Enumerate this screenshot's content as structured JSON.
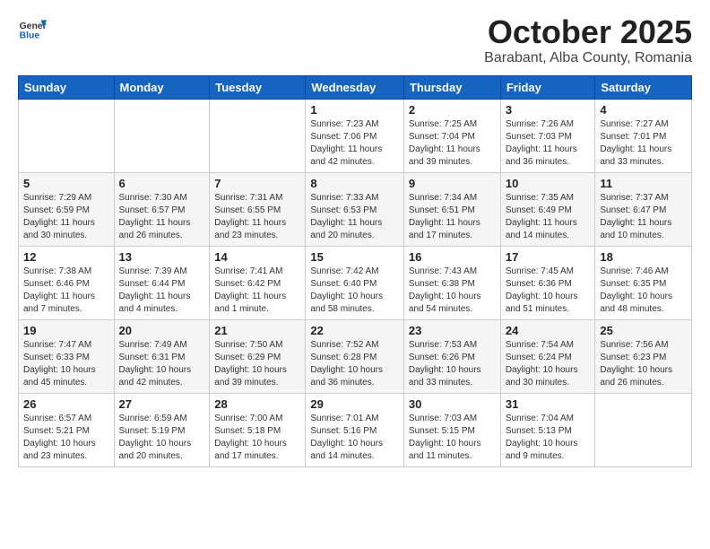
{
  "header": {
    "logo_general": "General",
    "logo_blue": "Blue",
    "month_title": "October 2025",
    "location": "Barabant, Alba County, Romania"
  },
  "weekdays": [
    "Sunday",
    "Monday",
    "Tuesday",
    "Wednesday",
    "Thursday",
    "Friday",
    "Saturday"
  ],
  "weeks": [
    [
      {
        "day": "",
        "info": ""
      },
      {
        "day": "",
        "info": ""
      },
      {
        "day": "",
        "info": ""
      },
      {
        "day": "1",
        "info": "Sunrise: 7:23 AM\nSunset: 7:06 PM\nDaylight: 11 hours and 42 minutes."
      },
      {
        "day": "2",
        "info": "Sunrise: 7:25 AM\nSunset: 7:04 PM\nDaylight: 11 hours and 39 minutes."
      },
      {
        "day": "3",
        "info": "Sunrise: 7:26 AM\nSunset: 7:03 PM\nDaylight: 11 hours and 36 minutes."
      },
      {
        "day": "4",
        "info": "Sunrise: 7:27 AM\nSunset: 7:01 PM\nDaylight: 11 hours and 33 minutes."
      }
    ],
    [
      {
        "day": "5",
        "info": "Sunrise: 7:29 AM\nSunset: 6:59 PM\nDaylight: 11 hours and 30 minutes."
      },
      {
        "day": "6",
        "info": "Sunrise: 7:30 AM\nSunset: 6:57 PM\nDaylight: 11 hours and 26 minutes."
      },
      {
        "day": "7",
        "info": "Sunrise: 7:31 AM\nSunset: 6:55 PM\nDaylight: 11 hours and 23 minutes."
      },
      {
        "day": "8",
        "info": "Sunrise: 7:33 AM\nSunset: 6:53 PM\nDaylight: 11 hours and 20 minutes."
      },
      {
        "day": "9",
        "info": "Sunrise: 7:34 AM\nSunset: 6:51 PM\nDaylight: 11 hours and 17 minutes."
      },
      {
        "day": "10",
        "info": "Sunrise: 7:35 AM\nSunset: 6:49 PM\nDaylight: 11 hours and 14 minutes."
      },
      {
        "day": "11",
        "info": "Sunrise: 7:37 AM\nSunset: 6:47 PM\nDaylight: 11 hours and 10 minutes."
      }
    ],
    [
      {
        "day": "12",
        "info": "Sunrise: 7:38 AM\nSunset: 6:46 PM\nDaylight: 11 hours and 7 minutes."
      },
      {
        "day": "13",
        "info": "Sunrise: 7:39 AM\nSunset: 6:44 PM\nDaylight: 11 hours and 4 minutes."
      },
      {
        "day": "14",
        "info": "Sunrise: 7:41 AM\nSunset: 6:42 PM\nDaylight: 11 hours and 1 minute."
      },
      {
        "day": "15",
        "info": "Sunrise: 7:42 AM\nSunset: 6:40 PM\nDaylight: 10 hours and 58 minutes."
      },
      {
        "day": "16",
        "info": "Sunrise: 7:43 AM\nSunset: 6:38 PM\nDaylight: 10 hours and 54 minutes."
      },
      {
        "day": "17",
        "info": "Sunrise: 7:45 AM\nSunset: 6:36 PM\nDaylight: 10 hours and 51 minutes."
      },
      {
        "day": "18",
        "info": "Sunrise: 7:46 AM\nSunset: 6:35 PM\nDaylight: 10 hours and 48 minutes."
      }
    ],
    [
      {
        "day": "19",
        "info": "Sunrise: 7:47 AM\nSunset: 6:33 PM\nDaylight: 10 hours and 45 minutes."
      },
      {
        "day": "20",
        "info": "Sunrise: 7:49 AM\nSunset: 6:31 PM\nDaylight: 10 hours and 42 minutes."
      },
      {
        "day": "21",
        "info": "Sunrise: 7:50 AM\nSunset: 6:29 PM\nDaylight: 10 hours and 39 minutes."
      },
      {
        "day": "22",
        "info": "Sunrise: 7:52 AM\nSunset: 6:28 PM\nDaylight: 10 hours and 36 minutes."
      },
      {
        "day": "23",
        "info": "Sunrise: 7:53 AM\nSunset: 6:26 PM\nDaylight: 10 hours and 33 minutes."
      },
      {
        "day": "24",
        "info": "Sunrise: 7:54 AM\nSunset: 6:24 PM\nDaylight: 10 hours and 30 minutes."
      },
      {
        "day": "25",
        "info": "Sunrise: 7:56 AM\nSunset: 6:23 PM\nDaylight: 10 hours and 26 minutes."
      }
    ],
    [
      {
        "day": "26",
        "info": "Sunrise: 6:57 AM\nSunset: 5:21 PM\nDaylight: 10 hours and 23 minutes."
      },
      {
        "day": "27",
        "info": "Sunrise: 6:59 AM\nSunset: 5:19 PM\nDaylight: 10 hours and 20 minutes."
      },
      {
        "day": "28",
        "info": "Sunrise: 7:00 AM\nSunset: 5:18 PM\nDaylight: 10 hours and 17 minutes."
      },
      {
        "day": "29",
        "info": "Sunrise: 7:01 AM\nSunset: 5:16 PM\nDaylight: 10 hours and 14 minutes."
      },
      {
        "day": "30",
        "info": "Sunrise: 7:03 AM\nSunset: 5:15 PM\nDaylight: 10 hours and 11 minutes."
      },
      {
        "day": "31",
        "info": "Sunrise: 7:04 AM\nSunset: 5:13 PM\nDaylight: 10 hours and 9 minutes."
      },
      {
        "day": "",
        "info": ""
      }
    ]
  ]
}
